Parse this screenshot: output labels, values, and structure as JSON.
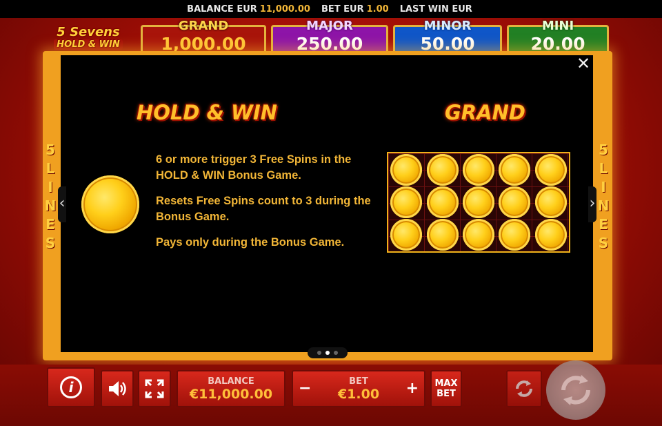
{
  "topbar": {
    "balance_label": "BALANCE EUR",
    "balance_value": "11,000.00",
    "bet_label": "BET EUR",
    "bet_value": "1.00",
    "last_win_label": "LAST WIN EUR",
    "last_win_value": ""
  },
  "logo": {
    "line1": "5 Sevens",
    "line2": "HOLD & WIN"
  },
  "jackpots": [
    {
      "name": "GRAND",
      "value": "1,000.00",
      "color": "#a8140a"
    },
    {
      "name": "MAJOR",
      "value": "250.00",
      "color": "#8d14a8"
    },
    {
      "name": "MINOR",
      "value": "50.00",
      "color": "#0f56c8"
    },
    {
      "name": "MINI",
      "value": "20.00",
      "color": "#218024"
    }
  ],
  "side_lines": {
    "number": "5",
    "word": [
      "L",
      "I",
      "N",
      "E",
      "S"
    ]
  },
  "paytable": {
    "left_heading": "HOLD & WIN",
    "right_heading": "GRAND",
    "descriptions": [
      "6 or more trigger 3 Free Spins in the HOLD & WIN Bonus Game.",
      "Resets Free Spins count to 3 during the Bonus Game.",
      "Pays only during the Bonus Game."
    ],
    "grid": {
      "rows": 3,
      "cols": 5,
      "icon": "gold-coin-icon"
    },
    "close_icon": "close-icon",
    "prev_icon": "chevron-left-icon",
    "next_icon": "chevron-right-icon",
    "pages": 3,
    "active_page": 2
  },
  "controls": {
    "info_icon": "info-icon",
    "sound_icon": "speaker-icon",
    "fullscreen_icon": "fullscreen-icon",
    "balance_label": "BALANCE",
    "balance_value": "€11,000.00",
    "bet_label": "BET",
    "bet_value": "€1.00",
    "minus": "−",
    "plus": "+",
    "max_line1": "MAX",
    "max_line2": "BET",
    "autoplay_icon": "autoplay-icon",
    "spin_icon": "spin-icon"
  },
  "colors": {
    "accent_gold": "#f2b637",
    "background_red": "#c41a0c",
    "panel": "#000000"
  }
}
